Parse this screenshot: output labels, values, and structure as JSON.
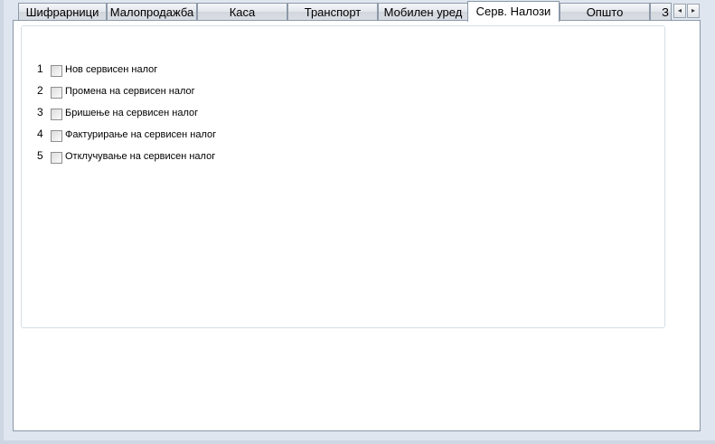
{
  "tabs": [
    {
      "label": "Шифрарници",
      "active": false
    },
    {
      "label": "Малопродажба",
      "active": false
    },
    {
      "label": "Каса",
      "active": false
    },
    {
      "label": "Транспорт",
      "active": false
    },
    {
      "label": "Мобилен уред",
      "active": false
    },
    {
      "label": "Серв. Налози",
      "active": true
    },
    {
      "label": "Општо",
      "active": false
    },
    {
      "label": "З",
      "active": false
    }
  ],
  "permissions": [
    {
      "number": "1",
      "label": "Нов сервисен налог",
      "checked": false
    },
    {
      "number": "2",
      "label": "Промена на сервисен налог",
      "checked": false
    },
    {
      "number": "3",
      "label": "Бришење на сервисен налог",
      "checked": false
    },
    {
      "number": "4",
      "label": "Фактурирање на сервисен налог",
      "checked": false
    },
    {
      "number": "5",
      "label": "Отклучување на сервисен налог",
      "checked": false
    }
  ],
  "icons": {
    "scroll_left": "◂",
    "scroll_right": "▸"
  }
}
